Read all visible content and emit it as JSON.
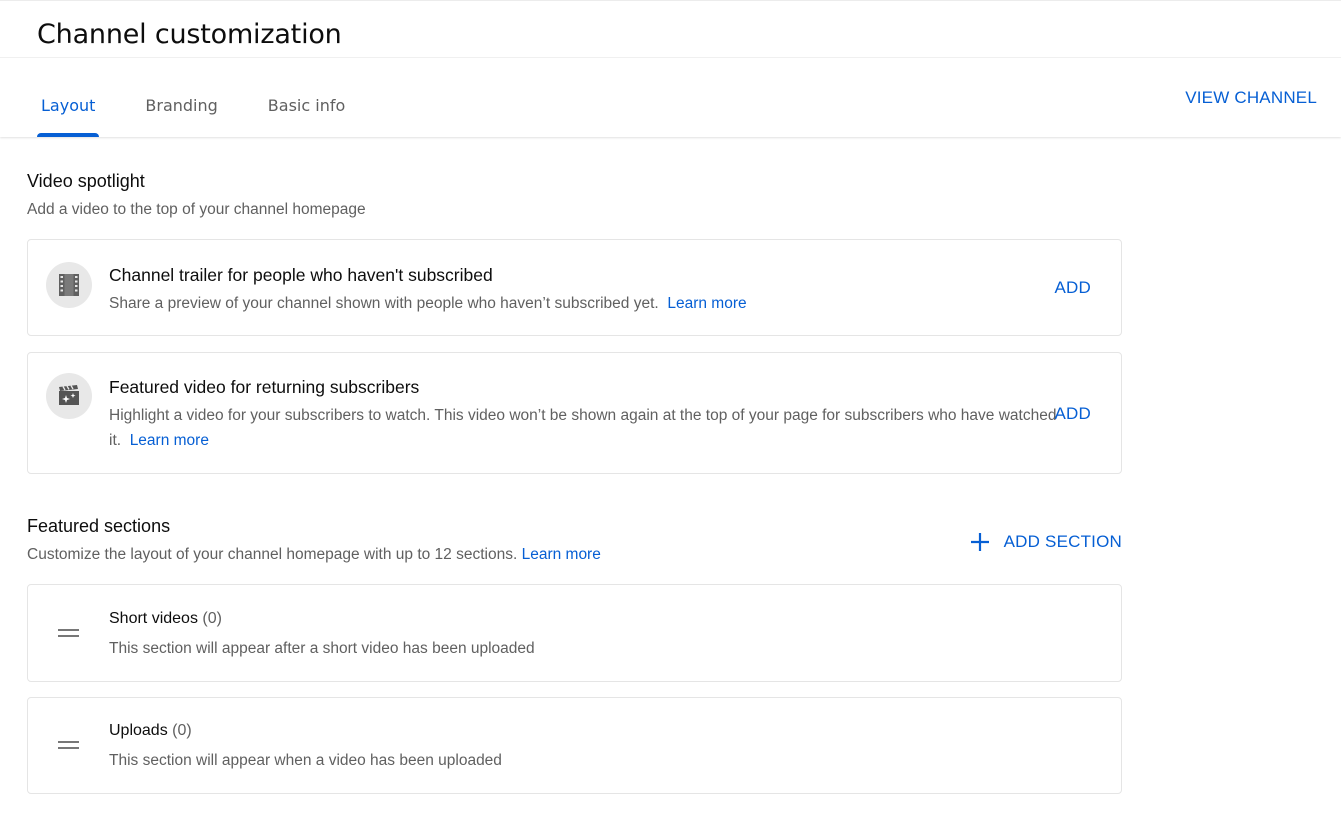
{
  "header": {
    "title": "Channel customization",
    "tabs": [
      {
        "label": "Layout",
        "active": true
      },
      {
        "label": "Branding",
        "active": false
      },
      {
        "label": "Basic info",
        "active": false
      }
    ],
    "view_channel_label": "VIEW CHANNEL"
  },
  "colors": {
    "accent": "#065fd4",
    "text_primary": "#0d0d0d",
    "text_secondary": "#606060"
  },
  "video_spotlight": {
    "title": "Video spotlight",
    "subtitle": "Add a video to the top of your channel homepage",
    "cards": [
      {
        "icon": "film-strip-icon",
        "title": "Channel trailer for people who haven't subscribed",
        "description": "Share a preview of your channel shown with people who haven’t subscribed yet.",
        "link": "Learn more",
        "action": "ADD"
      },
      {
        "icon": "clapperboard-sparkle-icon",
        "title": "Featured video for returning subscribers",
        "description": "Highlight a video for your subscribers to watch. This video won’t be shown again at the top of your page for subscribers who have watched it.",
        "link": "Learn more",
        "action": "ADD"
      }
    ]
  },
  "featured_sections": {
    "title": "Featured sections",
    "subtitle": "Customize the layout of your channel homepage with up to 12 sections.",
    "subtitle_link": "Learn more",
    "add_section_label": "ADD SECTION",
    "sections": [
      {
        "name": "Short videos",
        "count": "(0)",
        "description": "This section will appear after a short video has been uploaded"
      },
      {
        "name": "Uploads",
        "count": "(0)",
        "description": "This section will appear when a video has been uploaded"
      }
    ]
  }
}
